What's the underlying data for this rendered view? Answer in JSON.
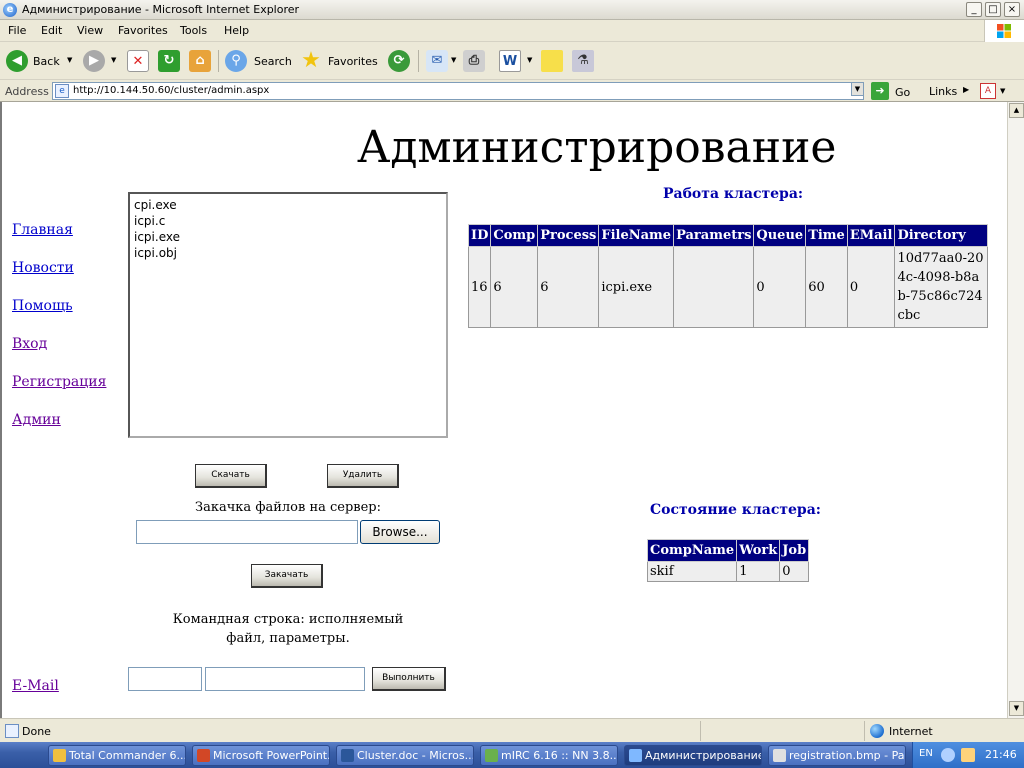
{
  "window": {
    "title": "Администрирование - Microsoft Internet Explorer"
  },
  "menu": [
    "File",
    "Edit",
    "View",
    "Favorites",
    "Tools",
    "Help"
  ],
  "toolbar": {
    "back": "Back",
    "search": "Search",
    "favorites": "Favorites"
  },
  "address": {
    "label": "Address",
    "url": "http://10.144.50.60/cluster/admin.aspx",
    "go": "Go",
    "links": "Links"
  },
  "page": {
    "title": "Администрирование",
    "nav": [
      {
        "label": "Главная",
        "visited": false
      },
      {
        "label": "Новости",
        "visited": false
      },
      {
        "label": "Помощь",
        "visited": false
      },
      {
        "label": "Вход",
        "visited": true
      },
      {
        "label": "Регистрация",
        "visited": true
      },
      {
        "label": "Админ",
        "visited": true
      }
    ],
    "email_link": "E-Mail",
    "files": [
      "cpi.exe",
      "icpi.c",
      "icpi.exe",
      "icpi.obj"
    ],
    "download_btn": "Скачать",
    "delete_btn": "Удалить",
    "upload_label": "Закачка файлов на сервер:",
    "browse_btn": "Browse...",
    "upload_btn": "Закачать",
    "cmd_label": "Командная строка: исполняемый файл, параметры.",
    "execute_btn": "Выполнить",
    "jobs_title": "Работа кластера:",
    "jobs_table": {
      "columns": [
        "ID",
        "Comp",
        "Process",
        "FileName",
        "Parametrs",
        "Queue",
        "Time",
        "EMail",
        "Directory"
      ],
      "rows": [
        [
          "16",
          "6",
          "6",
          "icpi.exe",
          "",
          "0",
          "60",
          "0",
          "10d77aa0-204c-4098-b8ab-75c86c724cbc"
        ]
      ]
    },
    "state_title": "Состояние кластера:",
    "state_table": {
      "columns": [
        "CompName",
        "Work",
        "Job"
      ],
      "rows": [
        [
          "skif",
          "1",
          "0"
        ]
      ]
    }
  },
  "status": {
    "text": "Done",
    "zone": "Internet"
  },
  "taskbar": {
    "items": [
      "Total Commander 6....",
      "Microsoft PowerPoint...",
      "Cluster.doc - Micros...",
      "mIRC 6.16 :: NN 3.8...",
      "Администрирование ...",
      "registration.bmp - Pa..."
    ],
    "lang": "EN",
    "clock": "21:46"
  }
}
